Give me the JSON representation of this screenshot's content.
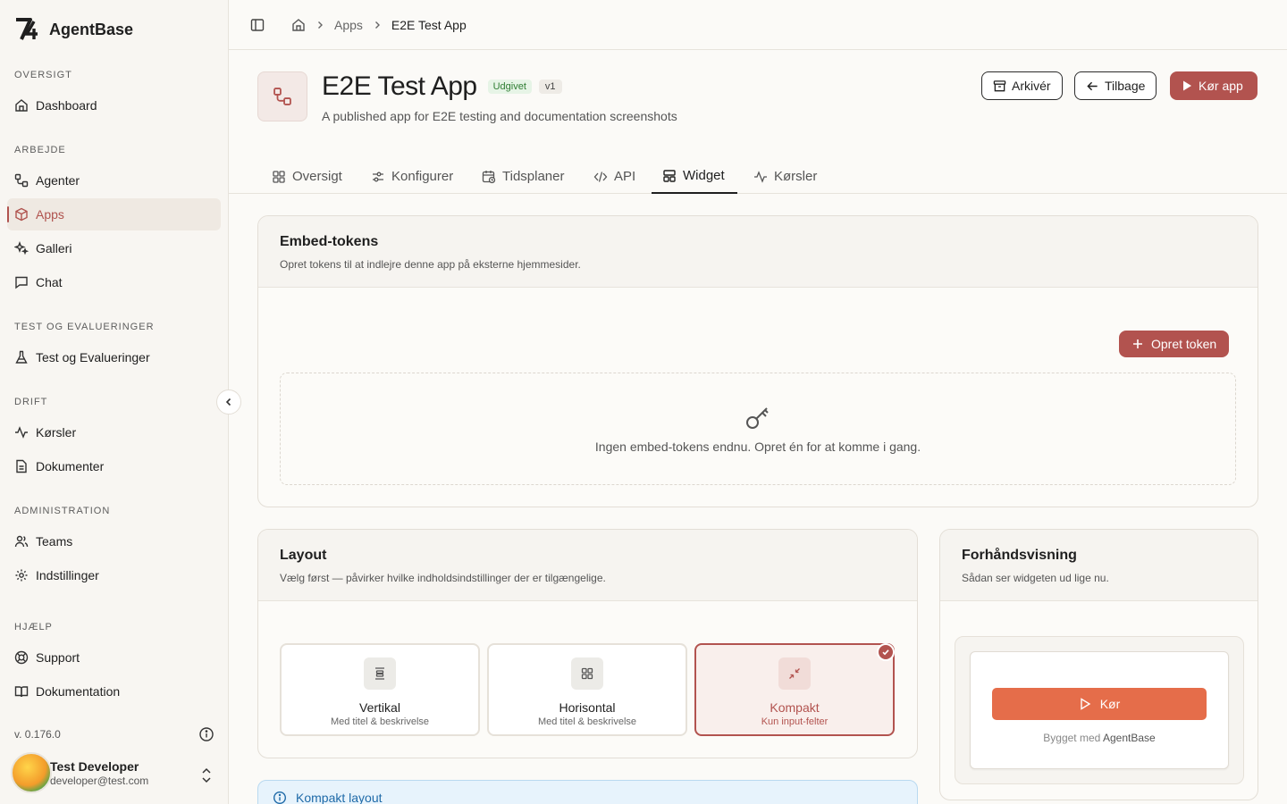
{
  "sidebar": {
    "brand": "AgentBase",
    "sections": {
      "oversigt": "OVERSIGT",
      "arbejde": "ARBEJDE",
      "test": "TEST OG EVALUERINGER",
      "drift": "DRIFT",
      "administration": "ADMINISTRATION",
      "hjaelp": "HJÆLP"
    },
    "items": {
      "dashboard": "Dashboard",
      "agenter": "Agenter",
      "apps": "Apps",
      "galleri": "Galleri",
      "chat": "Chat",
      "test": "Test og Evalueringer",
      "korsler": "Kørsler",
      "dokumenter": "Dokumenter",
      "teams": "Teams",
      "indstillinger": "Indstillinger",
      "support": "Support",
      "dokumentation": "Dokumentation"
    },
    "version": "v. 0.176.0",
    "user": {
      "name": "Test Developer",
      "email": "developer@test.com"
    }
  },
  "breadcrumb": {
    "apps": "Apps",
    "current": "E2E Test App"
  },
  "app": {
    "title": "E2E Test App",
    "status": "Udgivet",
    "version": "v1",
    "description": "A published app for E2E testing and documentation screenshots"
  },
  "actions": {
    "archive": "Arkivér",
    "back": "Tilbage",
    "run": "Kør app"
  },
  "tabs": {
    "oversigt": "Oversigt",
    "konfigurer": "Konfigurer",
    "tidsplaner": "Tidsplaner",
    "api": "API",
    "widget": "Widget",
    "korsler": "Kørsler"
  },
  "embed": {
    "title": "Embed-tokens",
    "subtitle": "Opret tokens til at indlejre denne app på eksterne hjemmesider.",
    "create_button": "Opret token",
    "empty": "Ingen embed-tokens endnu. Opret én for at komme i gang."
  },
  "layout": {
    "title": "Layout",
    "subtitle": "Vælg først — påvirker hvilke indholdsindstillinger der er tilgængelige.",
    "selected": "Kompakt",
    "options": {
      "vertikal": {
        "title": "Vertikal",
        "sub": "Med titel & beskrivelse"
      },
      "horisontal": {
        "title": "Horisontal",
        "sub": "Med titel & beskrivelse"
      },
      "kompakt": {
        "title": "Kompakt",
        "sub": "Kun input-felter"
      }
    }
  },
  "preview": {
    "title": "Forhåndsvisning",
    "subtitle": "Sådan ser widgeten ud lige nu.",
    "run_button": "Kør",
    "built_prefix": "Bygget med",
    "built_brand": "AgentBase"
  },
  "alert": {
    "title": "Kompakt layout"
  },
  "colors": {
    "accent": "#b2534f",
    "run": "#e56d4a",
    "published": "#2e7d32"
  }
}
